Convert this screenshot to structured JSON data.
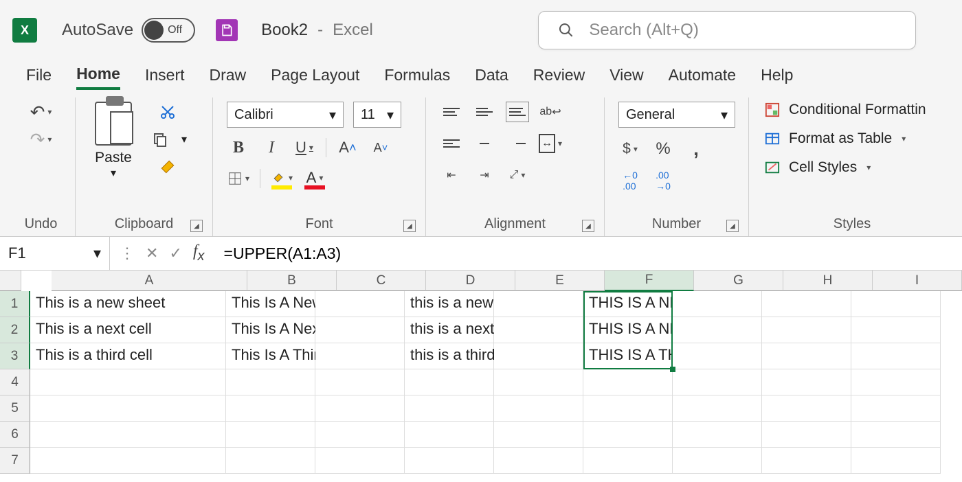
{
  "titlebar": {
    "autosave_label": "AutoSave",
    "autosave_state": "Off",
    "doc_name": "Book2",
    "doc_separator": "-",
    "app_name": "Excel",
    "search_placeholder": "Search (Alt+Q)"
  },
  "tabs": [
    "File",
    "Home",
    "Insert",
    "Draw",
    "Page Layout",
    "Formulas",
    "Data",
    "Review",
    "View",
    "Automate",
    "Help"
  ],
  "active_tab": "Home",
  "ribbon": {
    "undo_group": "Undo",
    "clipboard": {
      "paste_label": "Paste",
      "group": "Clipboard"
    },
    "font": {
      "name": "Calibri",
      "size": "11",
      "group": "Font"
    },
    "alignment": {
      "group": "Alignment",
      "wrap": "ab"
    },
    "number": {
      "format": "General",
      "group": "Number",
      "currency": "$",
      "percent": "%",
      "comma": ","
    },
    "styles": {
      "conditional": "Conditional Formattin",
      "table": "Format as Table",
      "cell": "Cell Styles",
      "group": "Styles"
    }
  },
  "formula_bar": {
    "namebox": "F1",
    "formula": "=UPPER(A1:A3)"
  },
  "columns": [
    "A",
    "B",
    "C",
    "D",
    "E",
    "F",
    "G",
    "H",
    "I"
  ],
  "selected_col": "F",
  "selected_rows": [
    1,
    2,
    3
  ],
  "rows": [
    1,
    2,
    3,
    4,
    5,
    6,
    7
  ],
  "cells": {
    "A1": "This is a new sheet",
    "A2": "This is a next cell",
    "A3": "This is a third cell",
    "B1": "This Is A New Sheet",
    "B2": "This Is A Next Cell",
    "B3": "This Is A Third Cell",
    "D1": "this is a new sheet",
    "D2": "this is a next cell",
    "D3": "this is a third cell",
    "F1": "THIS IS A NEW SHEET",
    "F2": "THIS IS A NEXT CELL",
    "F3": "THIS IS A THIRD CELL"
  },
  "selection": {
    "top": 0,
    "height": 3,
    "col": "F"
  }
}
